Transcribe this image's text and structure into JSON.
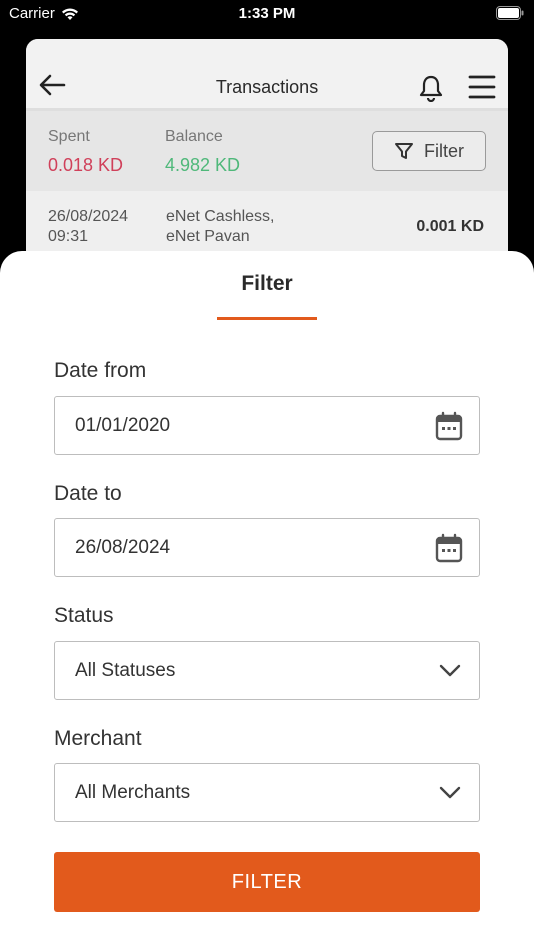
{
  "status_bar": {
    "carrier": "Carrier",
    "time": "1:33 PM"
  },
  "header": {
    "title": "Transactions",
    "icons": [
      "back-arrow-icon",
      "bell-icon",
      "hamburger-menu-icon"
    ]
  },
  "summary": {
    "spent_label": "Spent",
    "spent_value": "0.018 KD",
    "balance_label": "Balance",
    "balance_value": "4.982 KD",
    "filter_label": "Filter"
  },
  "transactions": [
    {
      "date": "26/08/2024",
      "time": "09:31",
      "merchant_line1": "eNet Cashless,",
      "merchant_line2": "eNet Pavan",
      "amount": "0.001 KD"
    }
  ],
  "sheet": {
    "title": "Filter",
    "date_from_label": "Date from",
    "date_from_value": "01/01/2020",
    "date_to_label": "Date to",
    "date_to_value": "26/08/2024",
    "status_label": "Status",
    "status_value": "All Statuses",
    "merchant_label": "Merchant",
    "merchant_value": "All Merchants",
    "submit_label": "FILTER"
  },
  "colors": {
    "accent": "#e25a1c",
    "spent": "#d0405a",
    "balance": "#4fb87a"
  }
}
